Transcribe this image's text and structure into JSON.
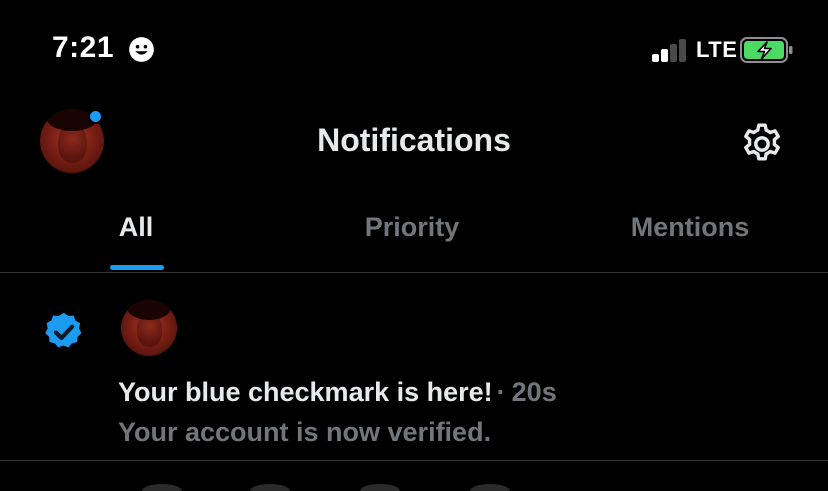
{
  "status_bar": {
    "time": "7:21",
    "network": "LTE",
    "signal_bars_active": 2,
    "signal_bars_total": 4,
    "battery_charging": true,
    "battery_color": "#4cd964"
  },
  "header": {
    "title": "Notifications",
    "has_unread_dot": true
  },
  "tabs": [
    {
      "label": "All",
      "active": true
    },
    {
      "label": "Priority",
      "active": false
    },
    {
      "label": "Mentions",
      "active": false
    }
  ],
  "notifications": [
    {
      "icon": "verified-badge-icon",
      "title": "Your blue checkmark is here!",
      "separator": "·",
      "time": "20s",
      "subtitle": "Your account is now verified."
    }
  ],
  "colors": {
    "accent": "#1d9bf0",
    "text_primary": "#e7e9ea",
    "text_secondary": "#71767b",
    "divider": "#2f3336",
    "background": "#000000"
  }
}
